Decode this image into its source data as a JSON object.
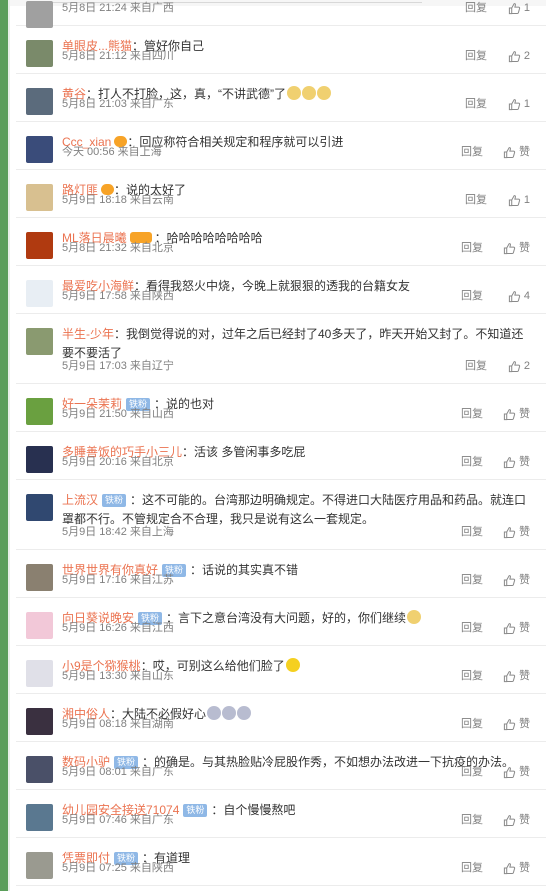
{
  "actions": {
    "reply_label": "回复"
  },
  "comments": [
    {
      "user": "",
      "badge": "",
      "vip": "",
      "text": "",
      "emoji": [],
      "time": "5月8日 21:24 来自广西",
      "likes": "1"
    },
    {
      "user": "单眼皮...熊猫",
      "badge": "",
      "vip": "",
      "text": "：管好你自己",
      "emoji": [],
      "time": "5月8日 21:12 来自四川",
      "likes": "2"
    },
    {
      "user": "黄谷",
      "badge": "",
      "vip": "",
      "text": "：打人不打脸，这，真，“不讲武德”了",
      "emoji": [
        "emoji-doge-icon",
        "emoji-doge-icon",
        "emoji-doge-icon"
      ],
      "time": "5月8日 21:03 来自广东",
      "likes": "1"
    },
    {
      "user": "Ccc_xian",
      "badge": "",
      "vip": "vip",
      "text": "：回应称符合相关规定和程序就可以引进",
      "emoji": [],
      "time": "今天 00:56 来自上海",
      "likes": "赞"
    },
    {
      "user": "路灯匪",
      "badge": "",
      "vip": "vip",
      "text": "：说的太好了",
      "emoji": [],
      "time": "5月9日 18:18 来自云南",
      "likes": "1"
    },
    {
      "user": "ML落日晨曦",
      "badge": "",
      "vip": "vip2",
      "text": "：哈哈哈哈哈哈哈哈",
      "emoji": [],
      "time": "5月8日 21:32 来自北京",
      "likes": "赞"
    },
    {
      "user": "最爱吃小海鲜",
      "badge": "",
      "vip": "",
      "text": "：看得我怒火中烧，今晚上就狠狠的透我的台籍女友",
      "emoji": [],
      "time": "5月9日 17:58 来自陕西",
      "likes": "4"
    },
    {
      "user": "半生-少年",
      "badge": "",
      "vip": "",
      "text": "：我倒觉得说的对，过年之后已经封了40多天了，昨天开始又封了。不知道还要不要活了",
      "emoji": [],
      "time": "5月9日 17:03 来自辽宁",
      "likes": "2"
    },
    {
      "user": "好一朵茉莉",
      "badge": "铁粉",
      "vip": "",
      "text": "：说的也对",
      "emoji": [],
      "time": "5月9日 21:50 来自山西",
      "likes": "赞"
    },
    {
      "user": "多睡善饭的巧手小三儿",
      "badge": "",
      "vip": "",
      "text": "：活该 多管闲事多吃屁",
      "emoji": [],
      "time": "5月9日 20:16 来自北京",
      "likes": "赞"
    },
    {
      "user": "上流汉",
      "badge": "铁粉",
      "vip": "",
      "text": "：这不可能的。台湾那边明确规定。不得进口大陆医疗用品和药品。就连口罩都不行。不管规定合不合理，我只是说有这么一套规定。",
      "emoji": [],
      "time": "5月9日 18:42 来自上海",
      "likes": "赞"
    },
    {
      "user": "世界世界有你真好",
      "badge": "铁粉",
      "vip": "",
      "text": "：话说的其实真不错",
      "emoji": [],
      "time": "5月9日 17:16 来自江苏",
      "likes": "赞"
    },
    {
      "user": "向日葵说晚安",
      "badge": "铁粉",
      "vip": "",
      "text": "：言下之意台湾没有大问题，好的，你们继续",
      "emoji": [
        "emoji-doge-icon"
      ],
      "time": "5月9日 16:26 来自江西",
      "likes": "赞"
    },
    {
      "user": "小9是个猕猴桃",
      "badge": "",
      "vip": "",
      "text": "：哎，可别这么给他们脸了",
      "emoji": [
        "emoji-smile-icon"
      ],
      "time": "5月9日 13:30 来自山东",
      "likes": "赞"
    },
    {
      "user": "湘中俗人",
      "badge": "",
      "vip": "",
      "text": "：大陆不必假好心",
      "emoji": [
        "emoji-mask-icon",
        "emoji-mask-icon",
        "emoji-mask-icon"
      ],
      "time": "5月9日 08:18 来自湖南",
      "likes": "赞"
    },
    {
      "user": "数码小驴",
      "badge": "铁粉",
      "vip": "",
      "text": "：的确是。与其热脸贴冷屁股作秀，不如想办法改进一下抗疫的办法。",
      "emoji": [],
      "time": "5月9日 08:01 来自广东",
      "likes": "赞"
    },
    {
      "user": "幼儿园安全接送71074",
      "badge": "铁粉",
      "vip": "",
      "text": "：自个慢慢熬吧",
      "emoji": [],
      "time": "5月9日 07:46 来自广东",
      "likes": "赞"
    },
    {
      "user": "凭票即付",
      "badge": "铁粉",
      "vip": "",
      "text": "：有道理",
      "emoji": [],
      "time": "5月9日 07:25 来自陕西",
      "likes": "赞"
    }
  ],
  "colors": {
    "username": "#eb7350",
    "badge": "#8fb8e6",
    "sidebar": "#5a9e5a",
    "avatars": [
      "#a0a0a0",
      "#7a8a6a",
      "#5b6b7c",
      "#3a4c7a",
      "#d8c090",
      "#b03a10",
      "#e8eef4",
      "#8a9a70",
      "#6aa040",
      "#283050",
      "#304870",
      "#8a8070",
      "#f2c8d8",
      "#e0e0e8",
      "#3a3040",
      "#4a5068",
      "#5a7890",
      "#9a9a90"
    ],
    "emoji": {
      "emoji-doge-icon": "#f0d070",
      "emoji-smile-icon": "#f5d020",
      "emoji-mask-icon": "#b8bcd0"
    }
  }
}
